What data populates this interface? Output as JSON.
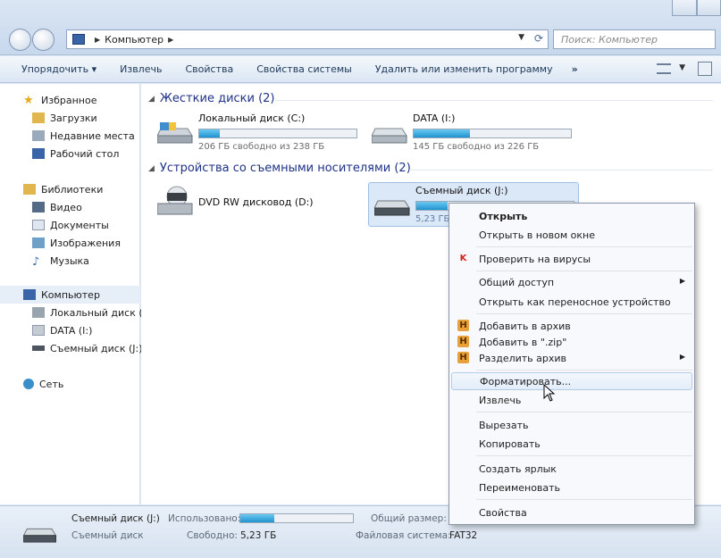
{
  "address": {
    "path": "Компьютер",
    "search_placeholder": "Поиск: Компьютер"
  },
  "toolbar": {
    "organize": "Упорядочить ▾",
    "eject": "Извлечь",
    "properties": "Свойства",
    "system_properties": "Свойства системы",
    "uninstall": "Удалить или изменить программу",
    "more": "»"
  },
  "sidebar": {
    "favorites": "Избранное",
    "downloads": "Загрузки",
    "recent": "Недавние места",
    "desktop": "Рабочий стол",
    "libraries": "Библиотеки",
    "video": "Видео",
    "documents": "Документы",
    "images": "Изображения",
    "music": "Музыка",
    "computer": "Компьютер",
    "local_disk": "Локальный диск (C",
    "data": "DATA (I:)",
    "removable": "Съемный диск (J:)",
    "network": "Сеть"
  },
  "groups": {
    "hdd": "Жесткие диски (2)",
    "removable": "Устройства со съемными носителями (2)"
  },
  "drives": {
    "c": {
      "name": "Локальный диск (C:)",
      "free": "206 ГБ свободно из 238 ГБ",
      "used": 0.13
    },
    "data": {
      "name": "DATA (I:)",
      "free": "145 ГБ свободно из 226 ГБ",
      "used": 0.36
    },
    "dvd": {
      "name": "DVD RW дисковод (D:)"
    },
    "j": {
      "name": "Съемный диск (J:)",
      "free": "5,23 ГБ",
      "used": 0.2
    }
  },
  "context_menu": {
    "open": "Открыть",
    "open_new": "Открыть в новом окне",
    "scan": "Проверить на вирусы",
    "share": "Общий доступ",
    "portable": "Открыть как переносное устройство",
    "add_archive": "Добавить в архив",
    "add_zip": "Добавить в \".zip\"",
    "split_archive": "Разделить архив",
    "format": "Форматировать...",
    "eject": "Извлечь",
    "cut": "Вырезать",
    "copy": "Копировать",
    "shortcut": "Создать ярлык",
    "rename": "Переименовать",
    "properties": "Свойства"
  },
  "status": {
    "name": "Съемный диск (J:)",
    "used_label": "Использовано:",
    "used_fraction": 0.3,
    "total_label": "Общий размер:",
    "type": "Съемный диск",
    "free_label": "Свободно:",
    "free_value": "5,23 ГБ",
    "fs_label": "Файловая система:",
    "fs_value": "FAT32"
  },
  "colors": {
    "bar_fill": "#1f93cf",
    "accent": "#1e3287"
  }
}
